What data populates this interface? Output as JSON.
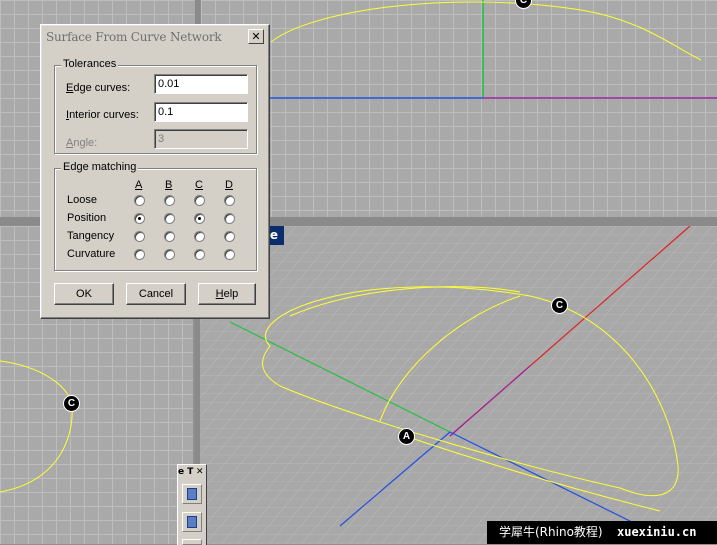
{
  "dialog": {
    "title": "Surface From Curve Network",
    "close_glyph": "✕",
    "tolerances": {
      "group_title": "Tolerances",
      "edge_label_u": "E",
      "edge_label_rest": "dge curves:",
      "edge_value": "0.01",
      "interior_label_u": "I",
      "interior_label_rest": "nterior curves:",
      "interior_value": "0.1",
      "angle_label_u": "A",
      "angle_label_rest": "ngle:",
      "angle_value": "3"
    },
    "edge_matching": {
      "group_title": "Edge matching",
      "columns": [
        "A",
        "B",
        "C",
        "D"
      ],
      "rows": [
        {
          "label": "Loose",
          "selected": [
            false,
            false,
            false,
            false
          ]
        },
        {
          "label": "Position",
          "selected": [
            true,
            false,
            true,
            false
          ]
        },
        {
          "label": "Tangency",
          "selected": [
            false,
            false,
            false,
            false
          ]
        },
        {
          "label": "Curvature",
          "selected": [
            false,
            false,
            false,
            false
          ]
        }
      ]
    },
    "buttons": {
      "ok": "OK",
      "cancel": "Cancel",
      "help_u": "H",
      "help_rest": "elp"
    }
  },
  "viewport_label": "ve",
  "markers": [
    "C",
    "C",
    "A",
    "C"
  ],
  "toolbar": {
    "head": "e T",
    "close_glyph": "✕"
  },
  "watermark": {
    "left": "学犀牛(Rhino教程)",
    "right": "xuexiniu.cn"
  },
  "colors": {
    "x_axis": "#e02020",
    "y_axis": "#20c040",
    "z_axis": "#2050e0",
    "curve": "#ffff33",
    "viewport_label_bg": "#0b2d6b"
  }
}
